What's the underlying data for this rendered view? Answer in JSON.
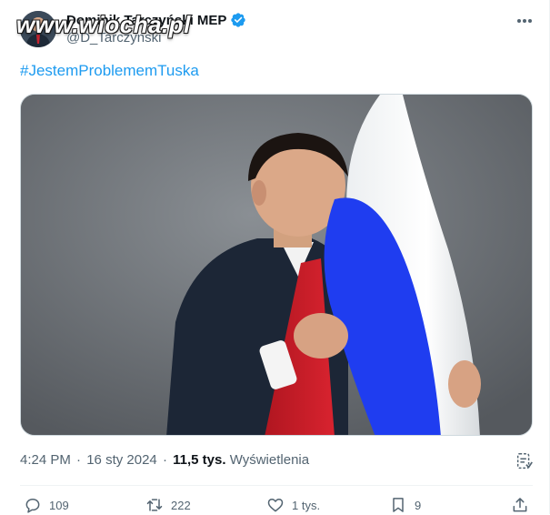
{
  "author": {
    "display_name": "Dominik Tarczyński MEP",
    "handle": "@D_Tarczynski",
    "verified": true
  },
  "watermark": "www.wiocha.pl",
  "tweet": {
    "hashtag": "#JestemProblememTuska",
    "media": {
      "flag_colors": {
        "top": "#ffffff",
        "middle": "#1f3df0",
        "bottom": "#d01f2b"
      },
      "background": "#74797e"
    },
    "time": "4:24 PM",
    "date": "16 sty 2024",
    "views_count": "11,5 tys.",
    "views_label": "Wyświetlenia"
  },
  "actions": {
    "reply_count": "109",
    "retweet_count": "222",
    "like_count": "1 tys.",
    "bookmark_count": "9"
  },
  "icons": [
    "verified-badge-icon",
    "more-dots-icon",
    "analytics-icon",
    "reply-icon",
    "retweet-icon",
    "like-icon",
    "bookmark-icon",
    "share-icon"
  ],
  "colors": {
    "accent": "#1d9bf0",
    "text": "#0f1419",
    "secondary": "#536471"
  }
}
